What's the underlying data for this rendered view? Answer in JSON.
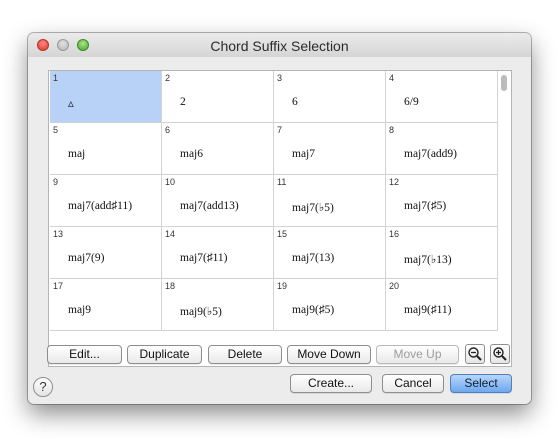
{
  "window": {
    "title": "Chord Suffix Selection"
  },
  "grid": {
    "cells": [
      {
        "n": "1",
        "s": "▵",
        "selected": true
      },
      {
        "n": "2",
        "s": "2"
      },
      {
        "n": "3",
        "s": "6"
      },
      {
        "n": "4",
        "s": "6/9"
      },
      {
        "n": "5",
        "s": "maj"
      },
      {
        "n": "6",
        "s": "maj6"
      },
      {
        "n": "7",
        "s": "maj7"
      },
      {
        "n": "8",
        "s": "maj7(add9)"
      },
      {
        "n": "9",
        "s": "maj7(add♯11)"
      },
      {
        "n": "10",
        "s": "maj7(add13)"
      },
      {
        "n": "11",
        "s": "maj7(♭5)"
      },
      {
        "n": "12",
        "s": "maj7(♯5)"
      },
      {
        "n": "13",
        "s": "maj7(9)"
      },
      {
        "n": "14",
        "s": "maj7(♯11)"
      },
      {
        "n": "15",
        "s": "maj7(13)"
      },
      {
        "n": "16",
        "s": "maj7(♭13)"
      },
      {
        "n": "17",
        "s": "maj9"
      },
      {
        "n": "18",
        "s": "maj9(♭5)"
      },
      {
        "n": "19",
        "s": "maj9(♯5)"
      },
      {
        "n": "20",
        "s": "maj9(♯11)"
      }
    ]
  },
  "toolbar": {
    "edit": "Edit...",
    "duplicate": "Duplicate",
    "delete": "Delete",
    "move_down": "Move Down",
    "move_up": "Move Up",
    "zoom_out_icon": "zoom-out-icon",
    "zoom_in_icon": "zoom-in-icon"
  },
  "footer": {
    "help": "?",
    "create": "Create...",
    "cancel": "Cancel",
    "select": "Select"
  }
}
